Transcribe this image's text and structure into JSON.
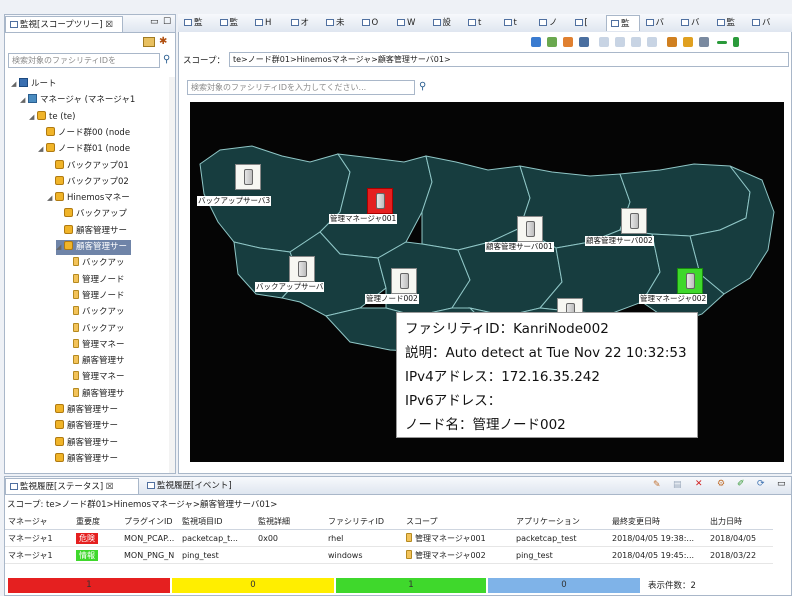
{
  "left_panel": {
    "tab_title": "監視[スコープツリー]",
    "search_placeholder": "検索対象のファシリティIDを",
    "tree": [
      {
        "label": "ルート",
        "icon": "root-icon",
        "level": 0
      },
      {
        "label": "マネージャ (マネージャ1",
        "icon": "manager-icon",
        "level": 1
      },
      {
        "label": "te (te)",
        "icon": "scope-icon",
        "level": 2
      },
      {
        "label": "ノード群00 (node",
        "icon": "scope-icon",
        "level": 3
      },
      {
        "label": "ノード群01 (node",
        "icon": "scope-icon",
        "level": 3
      },
      {
        "label": "バックアップ01",
        "icon": "scope-icon",
        "level": 4
      },
      {
        "label": "バックアップ02",
        "icon": "scope-icon",
        "level": 4
      },
      {
        "label": "Hinemosマネー",
        "icon": "scope-icon",
        "level": 4
      },
      {
        "label": "バックアップ",
        "icon": "scope-icon",
        "level": 5
      },
      {
        "label": "顧客管理サー",
        "icon": "scope-icon",
        "level": 5
      },
      {
        "label": "顧客管理サー",
        "icon": "scope-icon",
        "level": 5,
        "selected": true
      },
      {
        "label": "バックアッ",
        "icon": "node-icon",
        "level": 6
      },
      {
        "label": "管理ノード",
        "icon": "node-icon",
        "level": 6
      },
      {
        "label": "管理ノード",
        "icon": "node-icon",
        "level": 6
      },
      {
        "label": "バックアッ",
        "icon": "node-icon",
        "level": 6
      },
      {
        "label": "バックアッ",
        "icon": "node-icon",
        "level": 6
      },
      {
        "label": "管理マネー",
        "icon": "node-icon",
        "level": 6
      },
      {
        "label": "顧客管理サ",
        "icon": "node-icon",
        "level": 6
      },
      {
        "label": "管理マネー",
        "icon": "node-icon",
        "level": 6
      },
      {
        "label": "顧客管理サ",
        "icon": "node-icon",
        "level": 6
      },
      {
        "label": "顧客管理サー",
        "icon": "scope-icon",
        "level": 4
      },
      {
        "label": "顧客管理サー",
        "icon": "scope-icon",
        "level": 4
      },
      {
        "label": "顧客管理サー",
        "icon": "scope-icon",
        "level": 4
      },
      {
        "label": "顧客管理サー",
        "icon": "scope-icon",
        "level": 4
      }
    ]
  },
  "top_tabs": [
    "監",
    "監",
    "H",
    "オ",
    "未",
    "O",
    "W",
    "設",
    "t",
    "t",
    "ノ",
    "[",
    "監",
    "バ",
    "バ",
    "監",
    "バ"
  ],
  "map_view": {
    "scope_label": "スコープ：",
    "scope_path": "te>ノード群01>Hinemosマネージャ>顧客管理サーバ01>",
    "search_placeholder": "検索対象のファシリティIDを入力してください...",
    "nodes": [
      {
        "label": "バックアップサーバ3",
        "status": "normal"
      },
      {
        "label": "管理マネージャ001",
        "status": "critical"
      },
      {
        "label": "顧客管理サーバ001",
        "status": "normal"
      },
      {
        "label": "顧客管理サーバ002",
        "status": "normal"
      },
      {
        "label": "バックアップサーバ",
        "status": "normal"
      },
      {
        "label": "管理ノード002",
        "status": "normal"
      },
      {
        "label": "管理マネージャ002",
        "status": "info"
      },
      {
        "label": "",
        "status": "normal"
      }
    ],
    "tooltip": {
      "facility_id": "ファシリティID：KanriNode002",
      "description": "説明：Auto detect at Tue Nov 22 10:32:53",
      "ipv4": "IPv4アドレス：172.16.35.242",
      "ipv6": "IPv6アドレス：",
      "node_name": "ノード名：管理ノード002"
    }
  },
  "bottom": {
    "tabs": [
      "監視履歴[ステータス]",
      "監視履歴[イベント]"
    ],
    "scope_text": "スコープ: te>ノード群01>Hinemosマネージャ>顧客管理サーバ01>",
    "columns": [
      "マネージャ",
      "重要度",
      "プラグインID",
      "監視項目ID",
      "監視詳細",
      "ファシリティID",
      "スコープ",
      "アプリケーション",
      "最終変更日時",
      "出力日時"
    ],
    "rows": [
      {
        "manager": "マネージャ1",
        "severity": "危険",
        "severity_color": "#e52020",
        "plugin": "MON_PCAP...",
        "monitor": "packetcap_t...",
        "detail": "0x00",
        "facility": "rhel",
        "scope": "管理マネージャ001",
        "application": "packetcap_test",
        "last_modified": "2018/04/05 19:38:...",
        "output": "2018/04/05"
      },
      {
        "manager": "マネージャ1",
        "severity": "情報",
        "severity_color": "#3fd82c",
        "plugin": "MON_PNG_N",
        "monitor": "ping_test",
        "detail": "",
        "facility": "windows",
        "scope": "管理マネージャ002",
        "application": "ping_test",
        "last_modified": "2018/04/05 19:45:...",
        "output": "2018/03/22"
      }
    ],
    "summary": [
      {
        "count": "1",
        "color": "#e52020"
      },
      {
        "count": "0",
        "color": "#ffee00"
      },
      {
        "count": "1",
        "color": "#3fd82c"
      },
      {
        "count": "0",
        "color": "#7fb3e8"
      }
    ],
    "total_label": "表示件数：2"
  }
}
